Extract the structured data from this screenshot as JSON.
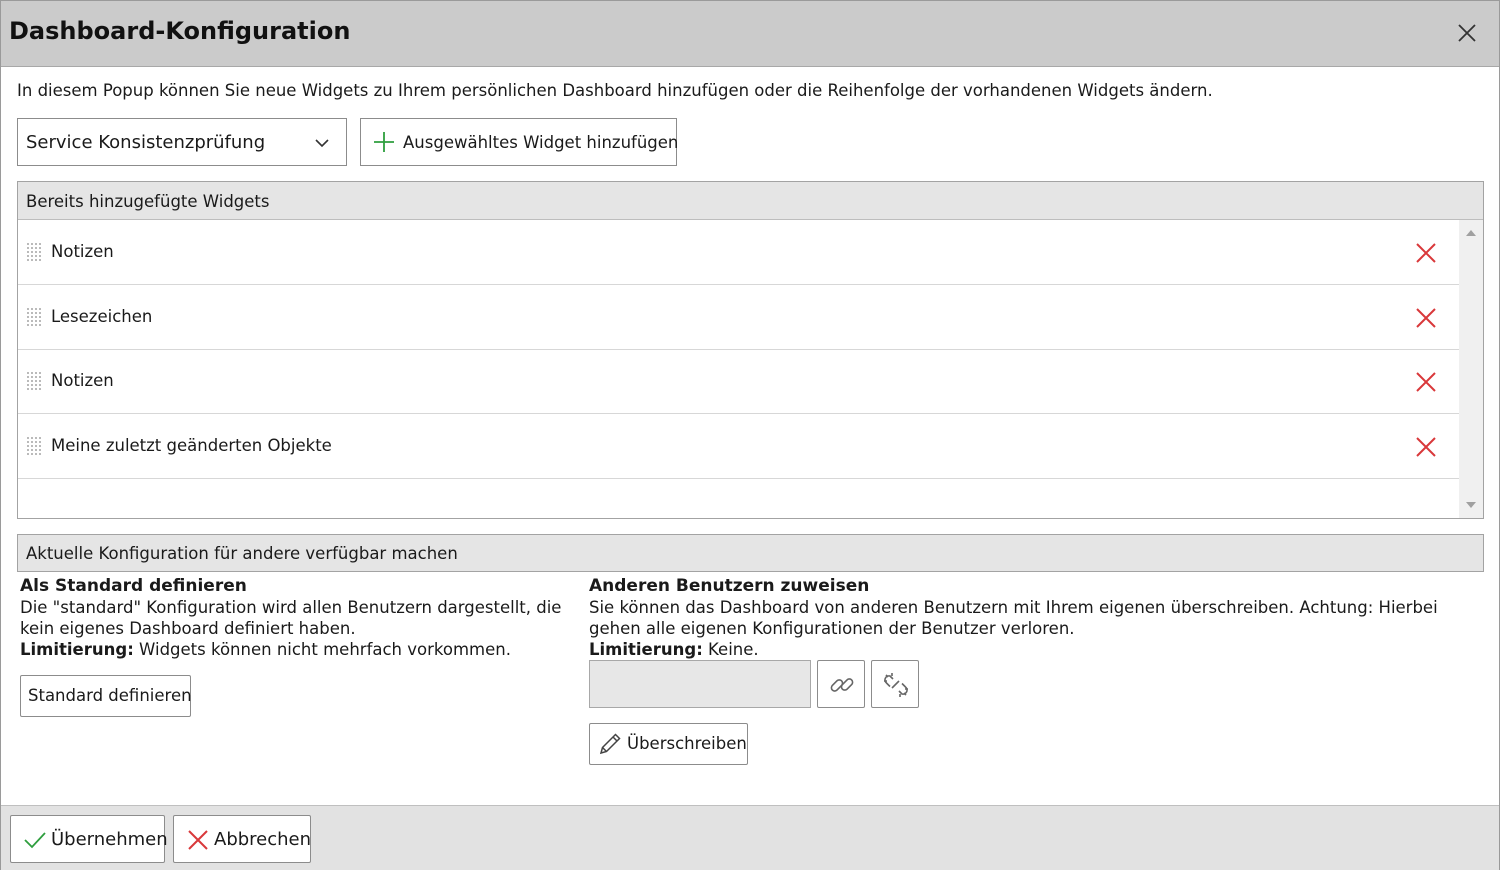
{
  "window": {
    "title": "Dashboard-Konfiguration"
  },
  "intro": "In diesem Popup können Sie neue Widgets zu Ihrem persönlichen Dashboard hinzufügen oder die Reihenfolge der vorhandenen Widgets ändern.",
  "widget_select": {
    "value": "Service Konsistenzprüfung"
  },
  "add_button": {
    "label": "Ausgewähltes Widget hinzufügen"
  },
  "added_widgets": {
    "header": "Bereits hinzugefügte Widgets",
    "items": [
      {
        "label": "Notizen"
      },
      {
        "label": "Lesezeichen"
      },
      {
        "label": "Notizen"
      },
      {
        "label": "Meine zuletzt geänderten Objekte"
      }
    ]
  },
  "share": {
    "header": "Aktuelle Konfiguration für andere verfügbar machen",
    "standard": {
      "title": "Als Standard definieren",
      "description": "Die \"standard\" Konfiguration wird allen Benutzern dargestellt, die kein eigenes Dashboard definiert haben.",
      "limit_label": "Limitierung:",
      "limit_text": " Widgets können nicht mehrfach vorkommen.",
      "button": "Standard definieren"
    },
    "assign": {
      "title": "Anderen Benutzern zuweisen",
      "description": "Sie können das Dashboard von anderen Benutzern mit Ihrem eigenen überschreiben. Achtung: Hierbei gehen alle eigenen Konfigurationen der Benutzer verloren.",
      "limit_label": "Limitierung:",
      "limit_text": " Keine.",
      "input_value": "",
      "button": "Überschreiben"
    }
  },
  "footer": {
    "ok": "Übernehmen",
    "cancel": "Abbrechen"
  },
  "colors": {
    "accent_green": "#2e9e3e",
    "delete_red": "#d9383a"
  },
  "icons": [
    "close-icon",
    "chevron-down-icon",
    "plus-icon",
    "drag-handle-icon",
    "delete-icon",
    "link-icon",
    "unlink-icon",
    "pencil-icon",
    "check-icon"
  ]
}
